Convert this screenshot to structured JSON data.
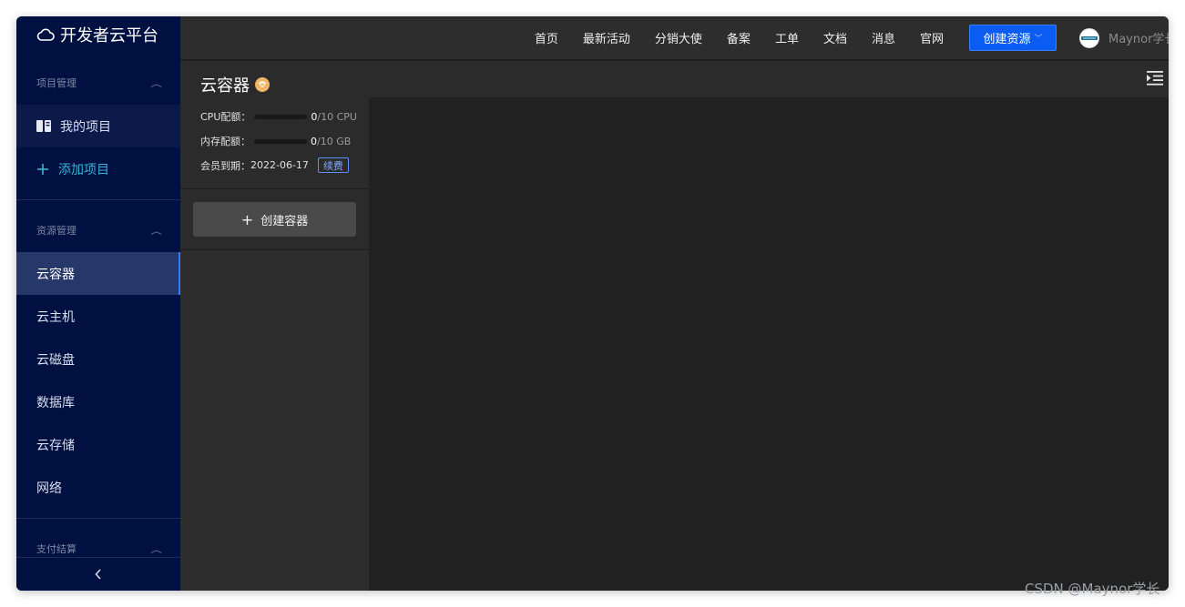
{
  "brand": {
    "title": "开发者云平台",
    "icon": "cloud-icon"
  },
  "sidebar": {
    "project_group": {
      "label": "项目管理"
    },
    "projects": [
      {
        "label": "我的项目",
        "icon": "book-icon"
      },
      {
        "label": "添加项目",
        "icon": "plus-icon"
      }
    ],
    "resource_group": {
      "label": "资源管理"
    },
    "resources": [
      {
        "label": "云容器",
        "active": true
      },
      {
        "label": "云主机"
      },
      {
        "label": "云磁盘"
      },
      {
        "label": "数据库"
      },
      {
        "label": "云存储"
      },
      {
        "label": "网络"
      }
    ],
    "billing_group": {
      "label": "支付结算"
    },
    "collapse_icon": "chevron-left-icon"
  },
  "topbar": {
    "links": [
      "首页",
      "最新活动",
      "分销大使",
      "备案",
      "工单",
      "文档",
      "消息",
      "官网"
    ],
    "create_button": "创建资源",
    "username": "Maynor学长"
  },
  "panel": {
    "title": "云容器",
    "cpu": {
      "label": "CPU配额：",
      "used": "0",
      "limit": "/10 CPU",
      "fraction": 0
    },
    "memory": {
      "label": "内存配额：",
      "used": "0",
      "limit": "/10 GB",
      "fraction": 0
    },
    "expire": {
      "label": "会员到期：",
      "date": "2022-06-17",
      "renew": "续费"
    },
    "create_button": "创建容器"
  },
  "watermark": "CSDN @Maynor学长",
  "colors": {
    "sidebar": "#001141",
    "accent": "#0a5cf2",
    "panel": "#2b2b2b",
    "main": "#212121"
  }
}
